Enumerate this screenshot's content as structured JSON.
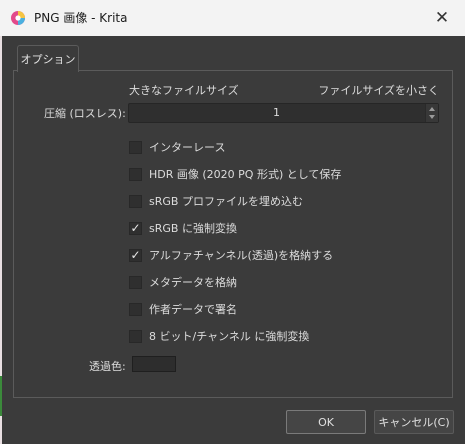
{
  "window": {
    "title": "PNG 画像 - Krita",
    "close_icon": "close-icon",
    "app_icon": "krita-logo-icon"
  },
  "tabs": [
    {
      "label": "オプション"
    }
  ],
  "compression": {
    "label": "圧縮 (ロスレス):",
    "min_label": "大きなファイルサイズ",
    "max_label": "ファイルサイズを小さく",
    "value": "1"
  },
  "options": [
    {
      "label": "インターレース",
      "checked": false
    },
    {
      "label": "HDR 画像 (2020 PQ 形式) として保存",
      "checked": false
    },
    {
      "label": "sRGB プロファイルを埋め込む",
      "checked": false
    },
    {
      "label": "sRGB に強制変換",
      "checked": true
    },
    {
      "label": "アルファチャンネル(透過)を格納する",
      "checked": true
    },
    {
      "label": "メタデータを格納",
      "checked": false
    },
    {
      "label": "作者データで署名",
      "checked": false
    },
    {
      "label": "8 ビット/チャンネル に強制変換",
      "checked": false
    }
  ],
  "transparency": {
    "label": "透過色:",
    "color": "#2d2d2d"
  },
  "buttons": {
    "ok": "OK",
    "cancel": "キャンセル(C)"
  }
}
